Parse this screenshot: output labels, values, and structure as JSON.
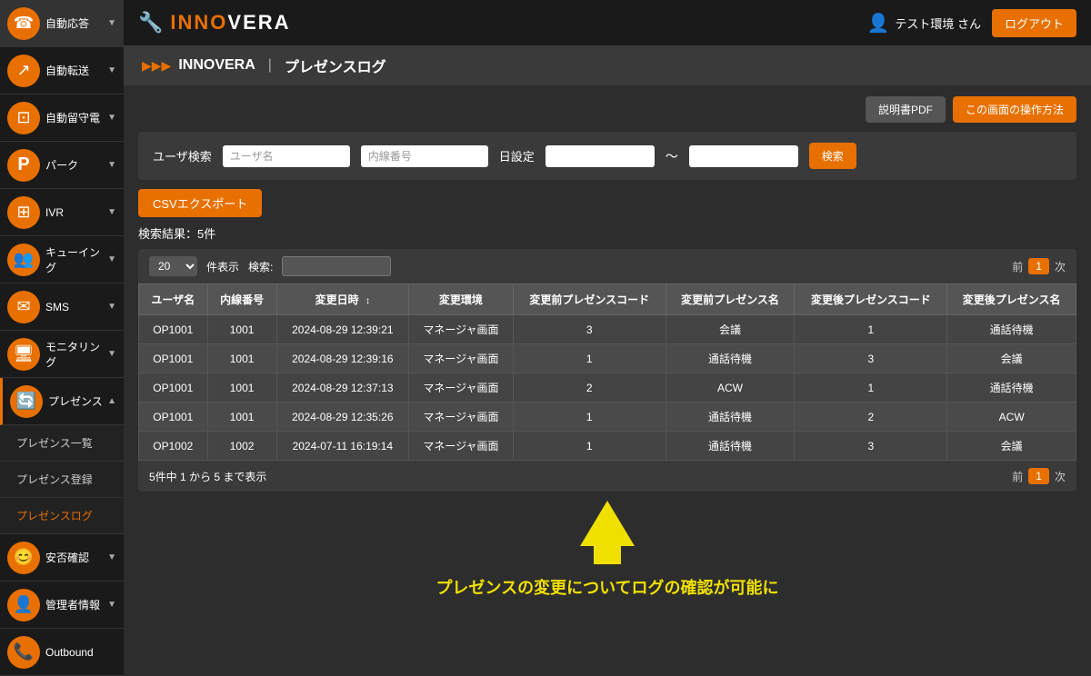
{
  "header": {
    "logo_text": "INNOVERA",
    "user_label": "テスト環境 さん",
    "logout_label": "ログアウト"
  },
  "breadcrumb": {
    "root": "INNOVERA",
    "separator": "|",
    "current": "プレゼンスログ"
  },
  "top_buttons": {
    "manual_pdf": "説明書PDF",
    "how_to": "この画面の操作方法"
  },
  "search": {
    "label": "ユーザ検索",
    "username_placeholder": "ユーザ名",
    "extension_placeholder": "内線番号",
    "date_label": "日設定",
    "search_btn": "検索"
  },
  "csv_btn": "CSVエクスポート",
  "result_count": "検索結果：5件",
  "table": {
    "per_page": "20",
    "per_page_label": "件表示",
    "search_label": "検索:",
    "prev_label": "前",
    "next_label": "次",
    "page_num": "1",
    "columns": [
      "ユーザ名",
      "内線番号",
      "変更日時",
      "変更環境",
      "変更前プレゼンスコード",
      "変更前プレゼンス名",
      "変更後プレゼンスコード",
      "変更後プレゼンス名"
    ],
    "rows": [
      [
        "OP1001",
        "1001",
        "2024-08-29 12:39:21",
        "マネージャ画面",
        "3",
        "会議",
        "1",
        "通話待機"
      ],
      [
        "OP1001",
        "1001",
        "2024-08-29 12:39:16",
        "マネージャ画面",
        "1",
        "通話待機",
        "3",
        "会議"
      ],
      [
        "OP1001",
        "1001",
        "2024-08-29 12:37:13",
        "マネージャ画面",
        "2",
        "ACW",
        "1",
        "通話待機"
      ],
      [
        "OP1001",
        "1001",
        "2024-08-29 12:35:26",
        "マネージャ画面",
        "1",
        "通話待機",
        "2",
        "ACW"
      ],
      [
        "OP1002",
        "1002",
        "2024-07-11 16:19:14",
        "マネージャ画面",
        "1",
        "通話待機",
        "3",
        "会議"
      ]
    ],
    "footer_info": "5件中 1 から 5 まで表示"
  },
  "annotation": {
    "text": "プレゼンスの変更についてログの確認が可能に"
  },
  "sidebar": {
    "items": [
      {
        "label": "自動応答",
        "icon": "☎",
        "has_chevron": true
      },
      {
        "label": "自動転送",
        "icon": "↗",
        "has_chevron": true
      },
      {
        "label": "自動留守電",
        "icon": "⊡",
        "has_chevron": true
      },
      {
        "label": "パーク",
        "icon": "P",
        "has_chevron": true
      },
      {
        "label": "IVR",
        "icon": "⊞",
        "has_chevron": true
      },
      {
        "label": "キューイング",
        "icon": "👥",
        "has_chevron": true
      },
      {
        "label": "SMS",
        "icon": "✉",
        "has_chevron": true
      },
      {
        "label": "モニタリング",
        "icon": "🖥",
        "has_chevron": true
      },
      {
        "label": "プレゼンス",
        "icon": "🔄",
        "has_chevron": true,
        "expanded": true
      }
    ],
    "sub_items": [
      {
        "label": "プレゼンス一覧",
        "active": false
      },
      {
        "label": "プレゼンス登録",
        "active": false
      },
      {
        "label": "プレゼンスログ",
        "active": true
      }
    ],
    "bottom_items": [
      {
        "label": "安否確認",
        "icon": "😊",
        "has_chevron": true
      },
      {
        "label": "管理者情報",
        "icon": "👤",
        "has_chevron": true
      },
      {
        "label": "Outbound",
        "icon": "📞",
        "has_chevron": false
      }
    ]
  }
}
